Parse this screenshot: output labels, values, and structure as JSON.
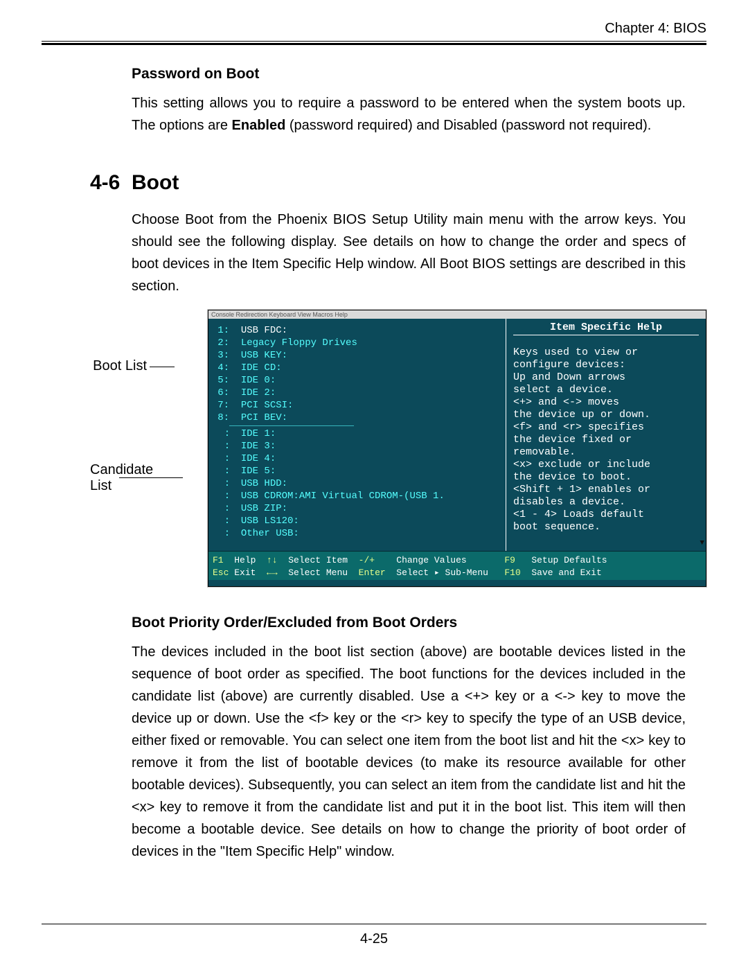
{
  "header": {
    "chapter": "Chapter 4: BIOS"
  },
  "s1": {
    "title": "Password on Boot",
    "p1a": "This setting allows you to require a password to be entered when the system boots up.  The options are ",
    "p1b": "Enabled",
    "p1c": " (password required) and Disabled (password not required)."
  },
  "h2": {
    "num": "4-6",
    "title": "Boot",
    "p": "Choose Boot from the Phoenix BIOS Setup Utility main menu with the arrow keys. You should see the following display.  See details on how to change the order and specs of boot devices in the Item Specific Help window.  All Boot BIOS settings are described in this section."
  },
  "annot": {
    "boot": "Boot List",
    "cand": "Candidate List"
  },
  "bios": {
    "menubar": "Console Redirection  Keyboard  View  Macros  Help",
    "boot_list": [
      {
        "n": "1:",
        "t": "USB FDC:"
      },
      {
        "n": "2:",
        "t": "Legacy Floppy Drives"
      },
      {
        "n": "3:",
        "t": "USB KEY:"
      },
      {
        "n": "4:",
        "t": "IDE CD:"
      },
      {
        "n": "5:",
        "t": "IDE 0:"
      },
      {
        "n": "6:",
        "t": "IDE 2:"
      },
      {
        "n": "7:",
        "t": "PCI SCSI:"
      },
      {
        "n": "8:",
        "t": "PCI BEV:"
      }
    ],
    "cand_list": [
      {
        "n": ":",
        "t": "IDE 1:"
      },
      {
        "n": ":",
        "t": "IDE 3:"
      },
      {
        "n": ":",
        "t": "IDE 4:"
      },
      {
        "n": ":",
        "t": "IDE 5:"
      },
      {
        "n": ":",
        "t": "USB HDD:"
      },
      {
        "n": ":",
        "t": "USB CDROM:AMI Virtual CDROM-(USB 1."
      },
      {
        "n": ":",
        "t": "USB ZIP:"
      },
      {
        "n": ":",
        "t": "USB LS120:"
      },
      {
        "n": ":",
        "t": "Other USB:"
      }
    ],
    "help_title": "Item Specific Help",
    "help": [
      "Keys used to view or",
      "configure devices:",
      "Up and Down arrows",
      "select a device.",
      "<+> and <-> moves",
      "the device up or down.",
      "<f> and <r> specifies",
      "the device fixed or",
      "removable.",
      "<x> exclude or include",
      "the device to boot.",
      "<Shift + 1> enables or",
      "disables a device.",
      "<1 - 4> Loads default",
      "boot sequence."
    ],
    "footer1": {
      "f1": "F1",
      "help": "Help",
      "arrows": "↑↓",
      "si": "Select Item",
      "pm": "-/+",
      "cv": "Change Values",
      "f9": "F9",
      "sd": "Setup Defaults"
    },
    "footer2": {
      "esc": "Esc",
      "exit": "Exit",
      "arrows": "←→",
      "sm": "Select Menu",
      "enter": "Enter",
      "ssm": "Select ▸ Sub-Menu",
      "f10": "F10",
      "se": "Save and Exit"
    }
  },
  "s3": {
    "title": "Boot Priority Order/Excluded from Boot Orders",
    "p": "The devices included in the boot list section (above) are bootable devices listed in the sequence of boot order as specified. The boot functions for the devices included in the candidate list (above) are currently disabled.  Use a <+> key or a <-> key to move the device up or down. Use the <f> key or the <r> key to specify the type of an USB device, either fixed or removable. You can select one item from the boot list and hit the <x> key to remove it from the list of bootable devices (to make its resource available for other bootable devices). Subsequently, you can select an item from the candidate list and hit the <x> key  to remove it from the candidate list and put it in the boot list. This item will then become a bootable device. See details on how to change the priority of boot order of devices in the \"Item Specific Help\" window."
  },
  "footer": {
    "pagenum": "4-25"
  }
}
